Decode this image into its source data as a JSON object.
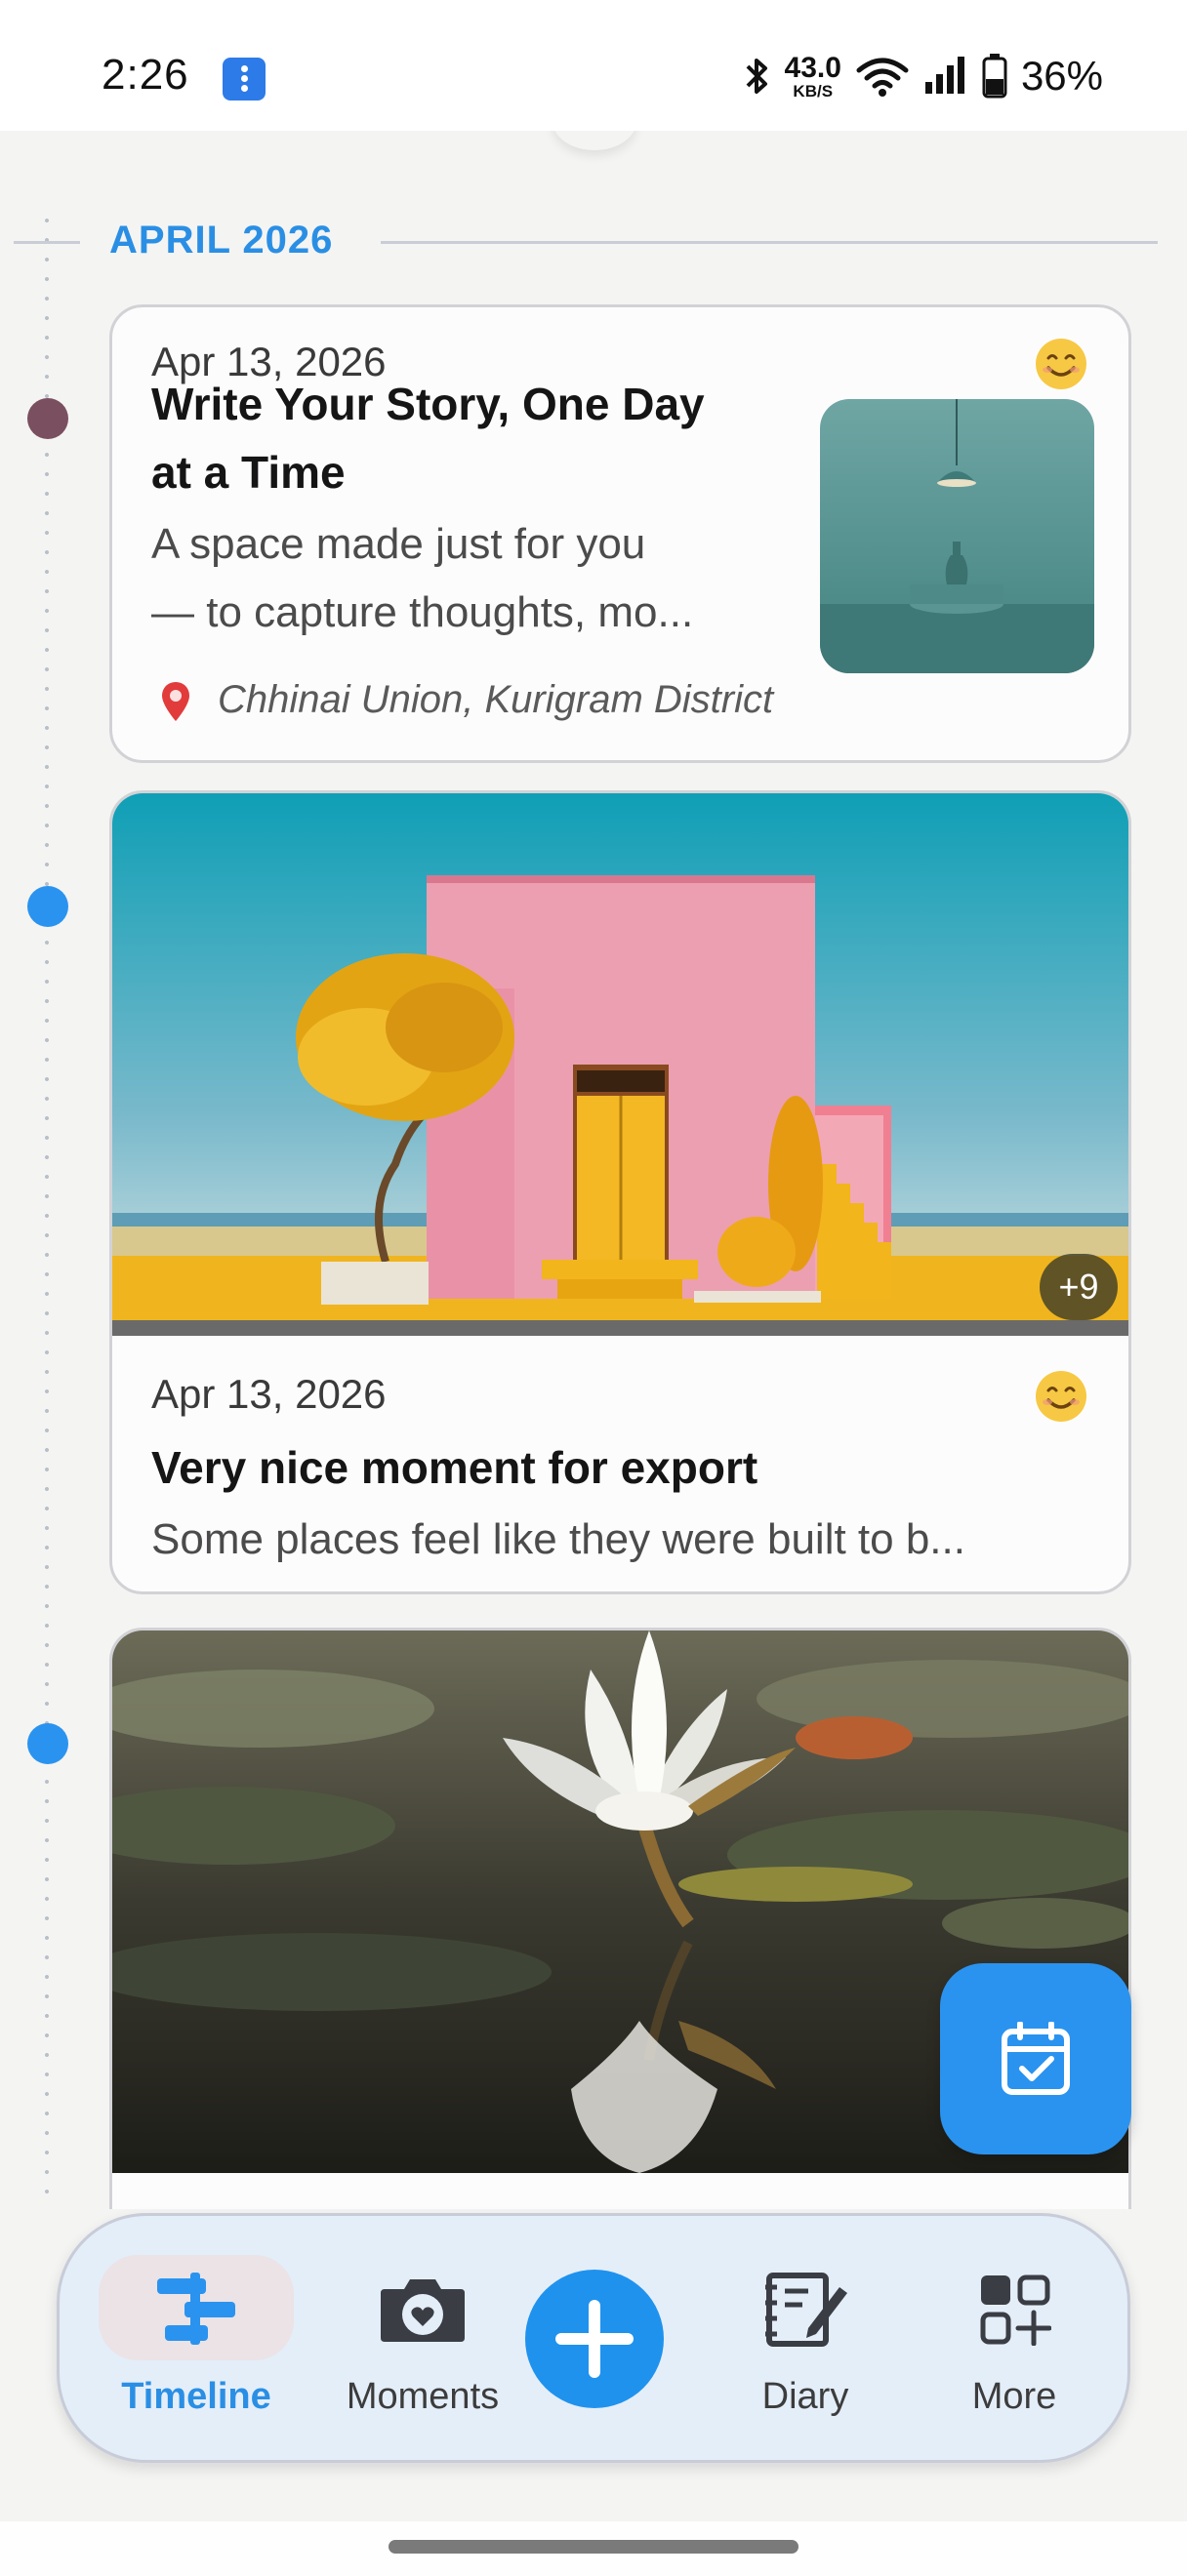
{
  "status_bar": {
    "time": "2:26",
    "net_speed_value": "43.0",
    "net_speed_unit": "KB/S",
    "battery_percent": "36%"
  },
  "timeline": {
    "month_label": "APRIL 2026",
    "dot_colors": [
      "#7a4f5f",
      "#2a93ef",
      "#2a93ef"
    ]
  },
  "entries": [
    {
      "date": "Apr 13, 2026",
      "mood_icon": "smiling-face",
      "title_line1": "Write Your Story, One Day",
      "title_line2": "at a Time",
      "text_line1": "A space made just for you",
      "text_line2": "— to capture thoughts, mo...",
      "location": "Chhinai Union, Kurigram District"
    },
    {
      "date": "Apr 13, 2026",
      "mood_icon": "smiling-face",
      "title": "Very nice moment for export",
      "text": "Some places feel like they were built to b...",
      "extra_photos": "+9"
    },
    {
      "image": "water-lily"
    }
  ],
  "fab": {
    "icon": "calendar-check-icon"
  },
  "nav": {
    "items": [
      {
        "label": "Timeline",
        "icon": "timeline-icon",
        "active": true
      },
      {
        "label": "Moments",
        "icon": "camera-heart-icon"
      },
      {
        "label": "",
        "icon": "plus-icon"
      },
      {
        "label": "Diary",
        "icon": "notebook-pen-icon"
      },
      {
        "label": "More",
        "icon": "grid-plus-icon"
      }
    ]
  },
  "colors": {
    "accent": "#2a93ef",
    "month_text": "#2a8fe4",
    "nav_background": "#e4eef9"
  }
}
